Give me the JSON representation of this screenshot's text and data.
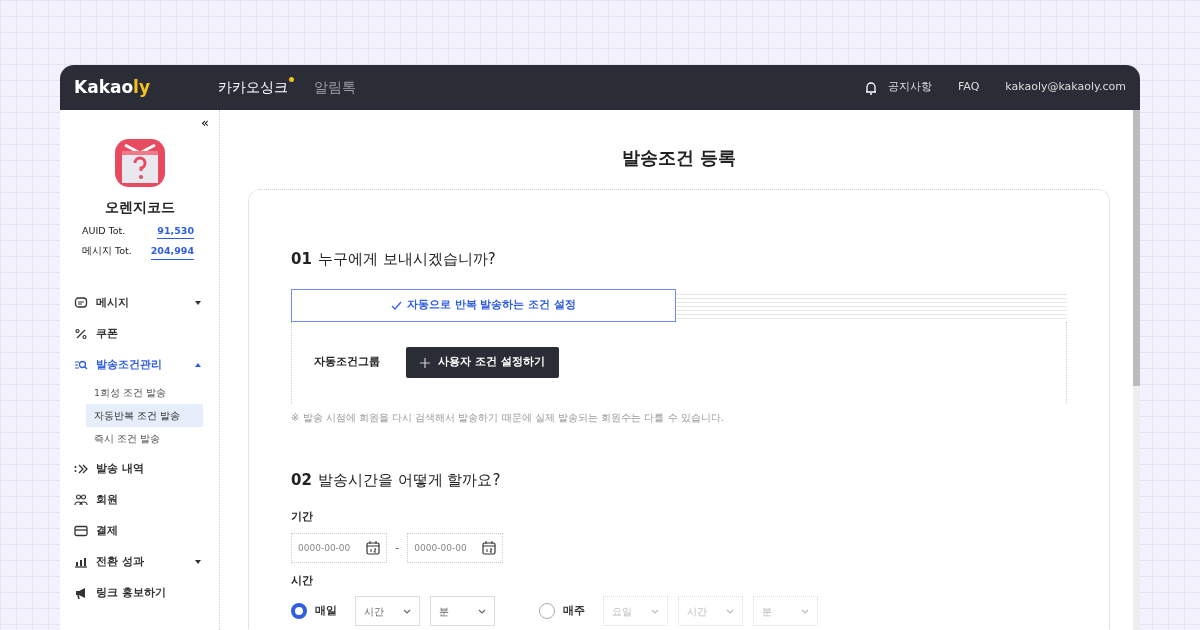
{
  "header": {
    "logo": {
      "text": "Kakao",
      "accent": "ly"
    },
    "tabs": [
      {
        "label": "카카오싱크",
        "selected": true,
        "new": true
      },
      {
        "label": "알림톡",
        "selected": false,
        "new": false
      }
    ],
    "links": [
      {
        "label": "공지사항",
        "kind": "notice"
      },
      {
        "label": "FAQ",
        "kind": "plain"
      },
      {
        "label": "kakaoly@kakaoly.com",
        "kind": "plain"
      }
    ]
  },
  "sidebar": {
    "collapse": "«",
    "profile": {
      "name": "오렌지코드",
      "stats": [
        {
          "label": "AUID Tot.",
          "value": "91,530"
        },
        {
          "label": "메시지 Tot.",
          "value": "204,994"
        }
      ]
    },
    "items": [
      {
        "label": "메시지",
        "kind": "message",
        "selected": false,
        "expanded": false
      },
      {
        "label": "쿠폰",
        "kind": "coupon",
        "selected": false
      },
      {
        "label": "발송조건관리",
        "kind": "condition",
        "selected": true,
        "expanded": true,
        "children": [
          {
            "label": "1회성 조건 발송",
            "selected": false
          },
          {
            "label": "자동반복 조건 발송",
            "selected": true
          },
          {
            "label": "즉시 조건 발송",
            "selected": false
          }
        ]
      },
      {
        "label": "발송 내역",
        "kind": "history",
        "selected": false
      },
      {
        "label": "회원",
        "kind": "members",
        "selected": false
      },
      {
        "label": "결제",
        "kind": "payment",
        "selected": false
      },
      {
        "label": "전환 성과",
        "kind": "performance",
        "selected": false,
        "expanded": false
      },
      {
        "label": "링크 홍보하기",
        "kind": "promotion",
        "selected": false
      }
    ]
  },
  "main": {
    "title": "발송조건 등록",
    "section_1": {
      "number": "01",
      "title": "누구에게 보내시겠습니까?",
      "option": {
        "label": "자동으로 반복 발송하는 조건 설정",
        "selected": true
      },
      "group_label": "자동조건그룹",
      "add_button": "사용자 조건 설정하기",
      "note": "※ 발송 시점에 회원을 다시 검색해서 발송하기 때문에 실제 발송되는 회원수는 다를 수 있습니다."
    },
    "section_2": {
      "number": "02",
      "title": "발송시간을 어떻게 할까요?",
      "period_label": "기간",
      "date_fields": [
        {
          "placeholder": "0000-00-00"
        },
        {
          "placeholder": "0000-00-00"
        }
      ],
      "date_separator": "-",
      "time_label": "시간",
      "options": [
        {
          "label": "매일",
          "selected": true,
          "disabled": false,
          "selects": [
            "시간",
            "분"
          ]
        },
        {
          "label": "매주",
          "selected": false,
          "disabled": true,
          "selects": [
            "요일",
            "시간",
            "분"
          ]
        }
      ]
    }
  }
}
